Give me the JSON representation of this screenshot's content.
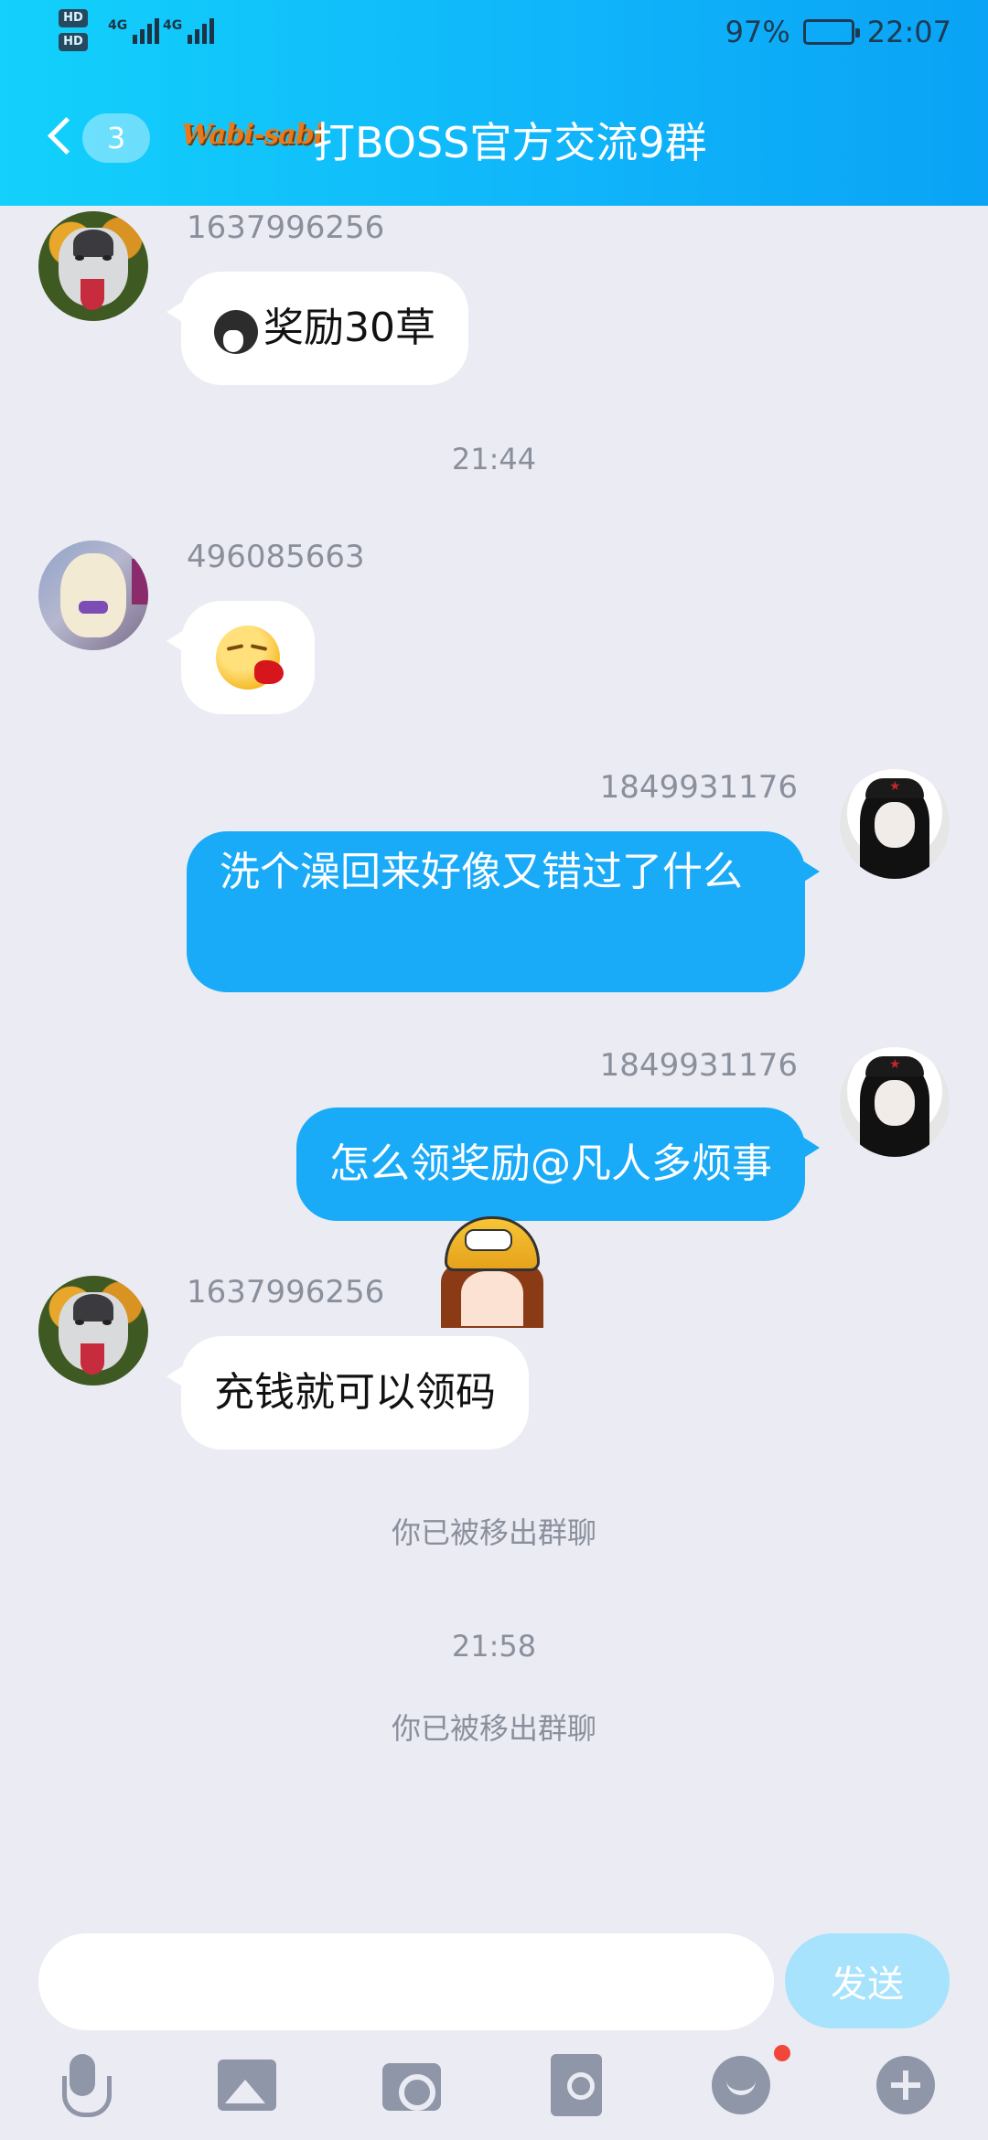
{
  "status_bar": {
    "hd1": "HD",
    "hd2": "HD",
    "sim1": "4G",
    "sim2": "4G",
    "battery_percent": "97%",
    "battery_level": 0.97,
    "time": "22:07"
  },
  "header": {
    "unread_count": "3",
    "group_logo": "Wabi-sabi",
    "title": "打BOSS官方交流9群",
    "background_color": "#10b6fa"
  },
  "messages": [
    {
      "sender": "1637996256",
      "text": "奖励30草",
      "direction": "incoming",
      "avatar": "husky"
    },
    {
      "time": "21:44"
    },
    {
      "sender": "496085663",
      "text": "",
      "emoji": "smile-spit-blood",
      "direction": "incoming",
      "avatar": "puppy"
    },
    {
      "sender": "1849931176",
      "text": "洗个澡回来好像又错过了什么",
      "direction": "outgoing",
      "avatar": "girl"
    },
    {
      "sender": "1849931176",
      "text": "怎么领奖励@凡人多烦事",
      "direction": "outgoing",
      "avatar": "girl"
    },
    {
      "sender": "1637996256",
      "text": "充钱就可以领码",
      "direction": "incoming",
      "avatar": "husky"
    },
    {
      "system": "你已被移出群聊"
    },
    {
      "time": "21:58"
    },
    {
      "system": "你已被移出群聊"
    }
  ],
  "input": {
    "value": "",
    "send_label": "发送"
  },
  "toolbar": {
    "icons": [
      "mic-icon",
      "image-icon",
      "camera-icon",
      "red-packet-icon",
      "emoji-icon",
      "plus-icon"
    ],
    "emoji_has_notification": true
  },
  "colors": {
    "outgoing_bubble": "#19aaf8",
    "incoming_bubble": "#ffffff",
    "chat_background": "#ebecf3",
    "send_button": "#a7e3fc"
  }
}
